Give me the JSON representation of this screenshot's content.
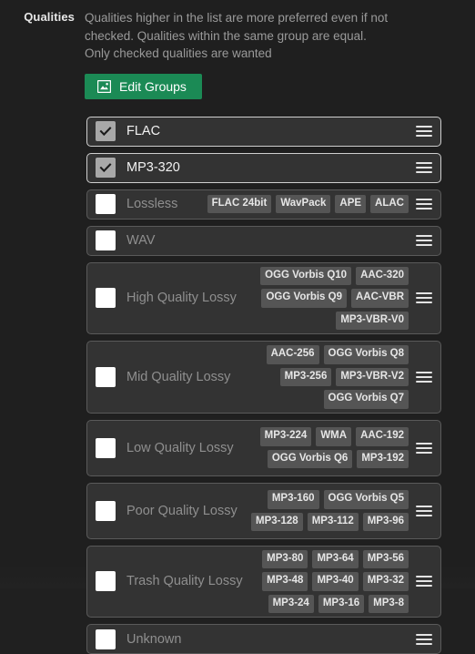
{
  "section": {
    "label": "Qualities",
    "help_text": "Qualities higher in the list are more preferred even if not checked. Qualities within the same group are equal. Only checked qualities are wanted"
  },
  "edit_groups_button": {
    "label": "Edit Groups",
    "icon": "image-icon",
    "color": "#1b8a55"
  },
  "colors": {
    "page_bg": "#1f1f1f",
    "row_bg": "#333333",
    "row_border": "#5a5a5a",
    "row_border_checked": "#cfcfcf",
    "tag_bg": "#555555",
    "checkbox_off": "#ffffff",
    "checkbox_on": "#a8a8a8",
    "text_muted": "#8f8f8f",
    "text_bright": "#f2f2f2",
    "accent_green": "#1b8a55"
  },
  "qualities": [
    {
      "name": "FLAC",
      "checked": true,
      "tags": []
    },
    {
      "name": "MP3-320",
      "checked": true,
      "tags": []
    },
    {
      "name": "Lossless",
      "checked": false,
      "tags": [
        "FLAC 24bit",
        "WavPack",
        "APE",
        "ALAC"
      ]
    },
    {
      "name": "WAV",
      "checked": false,
      "tags": []
    },
    {
      "name": "High Quality Lossy",
      "checked": false,
      "tags": [
        "OGG Vorbis Q10",
        "AAC-320",
        "OGG Vorbis Q9",
        "AAC-VBR",
        "MP3-VBR-V0"
      ]
    },
    {
      "name": "Mid Quality Lossy",
      "checked": false,
      "tags": [
        "AAC-256",
        "OGG Vorbis Q8",
        "MP3-256",
        "MP3-VBR-V2",
        "OGG Vorbis Q7"
      ]
    },
    {
      "name": "Low Quality Lossy",
      "checked": false,
      "tags": [
        "MP3-224",
        "WMA",
        "AAC-192",
        "OGG Vorbis Q6",
        "MP3-192"
      ]
    },
    {
      "name": "Poor Quality Lossy",
      "checked": false,
      "tags": [
        "MP3-160",
        "OGG Vorbis Q5",
        "MP3-128",
        "MP3-112",
        "MP3-96"
      ]
    },
    {
      "name": "Trash Quality Lossy",
      "checked": false,
      "tags": [
        "MP3-80",
        "MP3-64",
        "MP3-56",
        "MP3-48",
        "MP3-40",
        "MP3-32",
        "MP3-24",
        "MP3-16",
        "MP3-8"
      ]
    },
    {
      "name": "Unknown",
      "checked": false,
      "tags": []
    }
  ]
}
